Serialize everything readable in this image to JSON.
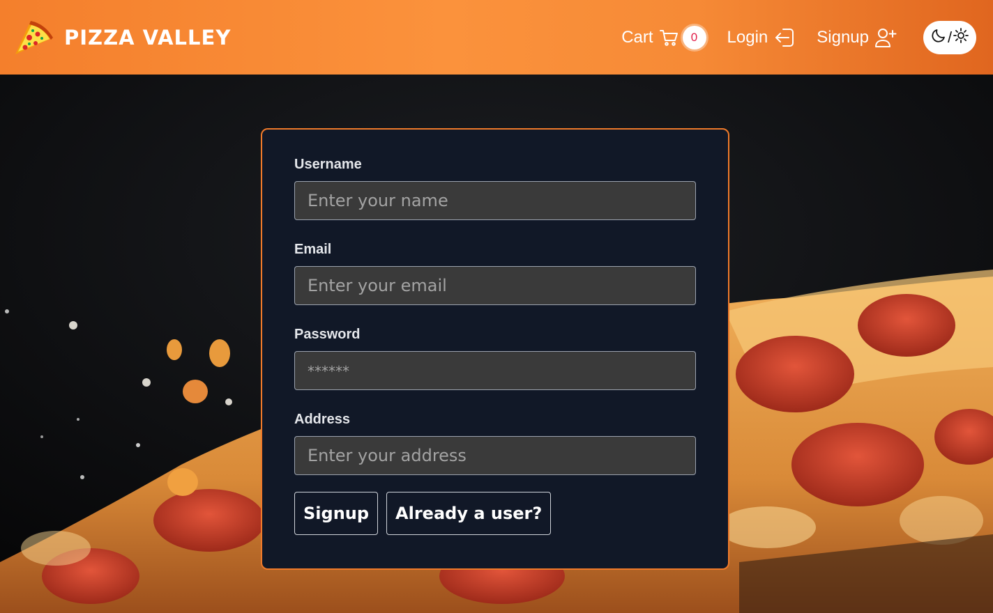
{
  "navbar": {
    "brand_name": "PIZZA VALLEY",
    "brand_icon": "pizza-slice-icon",
    "cart_label": "Cart",
    "cart_icon": "cart-icon",
    "cart_count": "0",
    "login_label": "Login",
    "login_icon": "login-icon",
    "signup_label": "Signup",
    "signup_icon": "user-plus-icon",
    "theme_toggle": {
      "moon_icon": "moon-icon",
      "separator": "/",
      "sun_icon": "sun-icon"
    }
  },
  "form": {
    "username": {
      "label": "Username",
      "placeholder": "Enter your name"
    },
    "email": {
      "label": "Email",
      "placeholder": "Enter your email"
    },
    "password": {
      "label": "Password",
      "placeholder": "******"
    },
    "address": {
      "label": "Address",
      "placeholder": "Enter your address"
    },
    "signup_button": "Signup",
    "login_link_button": "Already a user?"
  },
  "colors": {
    "navbar_orange": "#fb923c",
    "card_background": "#111827",
    "card_border": "#f07a2a",
    "input_background": "#3a3a3a",
    "badge_text": "#e11d48"
  }
}
